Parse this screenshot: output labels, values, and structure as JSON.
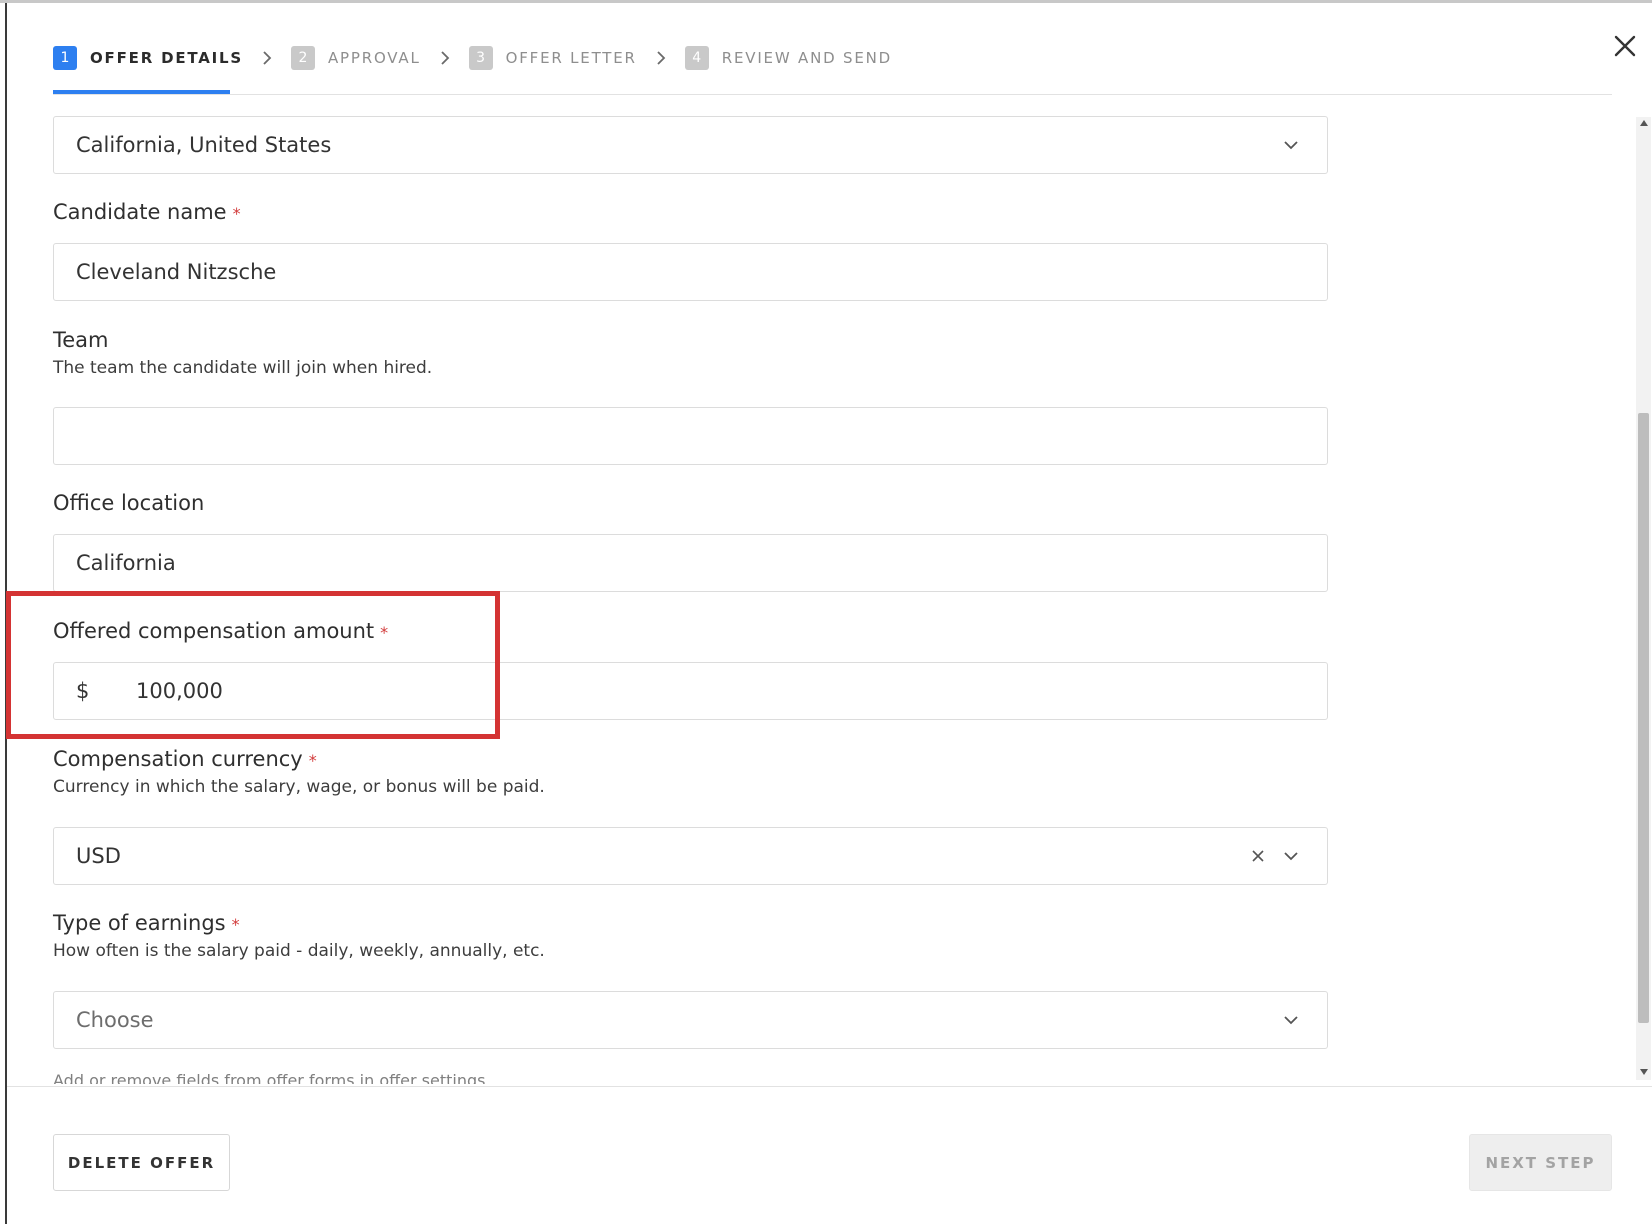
{
  "stepper": {
    "steps": [
      {
        "num": "1",
        "label": "OFFER DETAILS"
      },
      {
        "num": "2",
        "label": "APPROVAL"
      },
      {
        "num": "3",
        "label": "OFFER LETTER"
      },
      {
        "num": "4",
        "label": "REVIEW AND SEND"
      }
    ],
    "active_step": 1
  },
  "form": {
    "location_select": {
      "value": "California, United States"
    },
    "candidate_name": {
      "label": "Candidate name",
      "required": "*",
      "value": "Cleveland Nitzsche"
    },
    "team": {
      "label": "Team",
      "help": "The team the candidate will join when hired.",
      "value": ""
    },
    "office_location": {
      "label": "Office location",
      "value": "California"
    },
    "compensation_amount": {
      "label": "Offered compensation amount",
      "required": "*",
      "currency_symbol": "$",
      "value": "100,000"
    },
    "compensation_currency": {
      "label": "Compensation currency",
      "required": "*",
      "help": "Currency in which the salary, wage, or bonus will be paid.",
      "value": "USD"
    },
    "earnings_type": {
      "label": "Type of earnings",
      "required": "*",
      "help": "How often is the salary paid - daily, weekly, annually, etc.",
      "placeholder": "Choose"
    },
    "settings_note": "Add or remove fields from offer forms in offer settings"
  },
  "footer": {
    "delete_label": "DELETE OFFER",
    "next_label": "NEXT STEP"
  },
  "icons": {
    "close": "close-icon",
    "chevron": "chevron-right-icon",
    "dropdown": "chevron-down-icon",
    "clear": "clear-icon"
  },
  "colors": {
    "accent": "#2d7ff0",
    "required": "#d23b3b",
    "highlight": "#d43333"
  }
}
